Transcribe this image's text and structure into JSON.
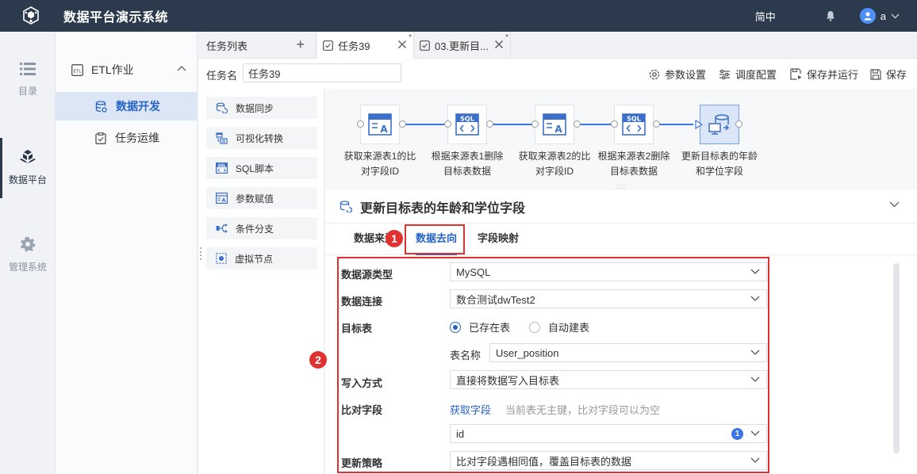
{
  "app": {
    "title": "数据平台演示系统",
    "language": "简中",
    "user": "a",
    "brand_color": "#2c3a4d",
    "accent_color": "#2563c9"
  },
  "leftnav": [
    {
      "label": "目录",
      "icon": "list-icon"
    },
    {
      "label": "数据平台",
      "icon": "cubes-icon",
      "active": true
    },
    {
      "label": "管理系统",
      "icon": "gear-icon"
    }
  ],
  "secnav": {
    "group": "ETL作业",
    "items": [
      {
        "label": "数据开发",
        "icon": "database-icon",
        "active": true
      },
      {
        "label": "任务运维",
        "icon": "clipboard-icon"
      }
    ]
  },
  "tabs": {
    "list_label": "任务列表",
    "add": "+",
    "items": [
      {
        "label": "任务39",
        "modified": "*",
        "active": true
      },
      {
        "label": "03.更新目...",
        "modified": "*"
      }
    ]
  },
  "task": {
    "name_label": "任务名",
    "name_value": "任务39",
    "buttons": {
      "params": "参数设置",
      "schedule": "调度配置",
      "save_run": "保存并运行",
      "save": "保存"
    }
  },
  "palette": [
    "数据同步",
    "可视化转换",
    "SQL脚本",
    "参数赋值",
    "条件分支",
    "虚拟节点"
  ],
  "flow": {
    "nodes": [
      {
        "label1": "获取来源表1的比",
        "label2": "对字段ID",
        "type": "param"
      },
      {
        "label1": "根据来源表1删除",
        "label2": "目标表数据",
        "type": "sql"
      },
      {
        "label1": "获取来源表2的比",
        "label2": "对字段ID",
        "type": "param"
      },
      {
        "label1": "根据来源表2删除",
        "label2": "目标表数据",
        "type": "sql"
      },
      {
        "label1": "更新目标表的年龄",
        "label2": "和学位字段",
        "type": "sync",
        "selected": true
      }
    ],
    "grip": "::::"
  },
  "detail": {
    "title": "更新目标表的年龄和学位字段",
    "tabs": [
      "数据来源",
      "数据去向",
      "字段映射"
    ],
    "active_tab": "数据去向",
    "callouts": [
      "1",
      "2"
    ],
    "form": {
      "source_type_label": "数据源类型",
      "source_type": "MySQL",
      "connection_label": "数据连接",
      "connection": "数合测试dwTest2",
      "target_label": "目标表",
      "radio_existing": "已存在表",
      "radio_auto": "自动建表",
      "table_name_label": "表名称",
      "table_name": "User_position",
      "write_label": "写入方式",
      "write_mode": "直接将数据写入目标表",
      "compare_label": "比对字段",
      "compare_link": "获取字段",
      "compare_hint": "当前表无主键，比对字段可以为空",
      "compare_value": "id",
      "compare_count": "1",
      "strategy_label": "更新策略",
      "strategy": "比对字段遇相同值，覆盖目标表的数据"
    }
  }
}
